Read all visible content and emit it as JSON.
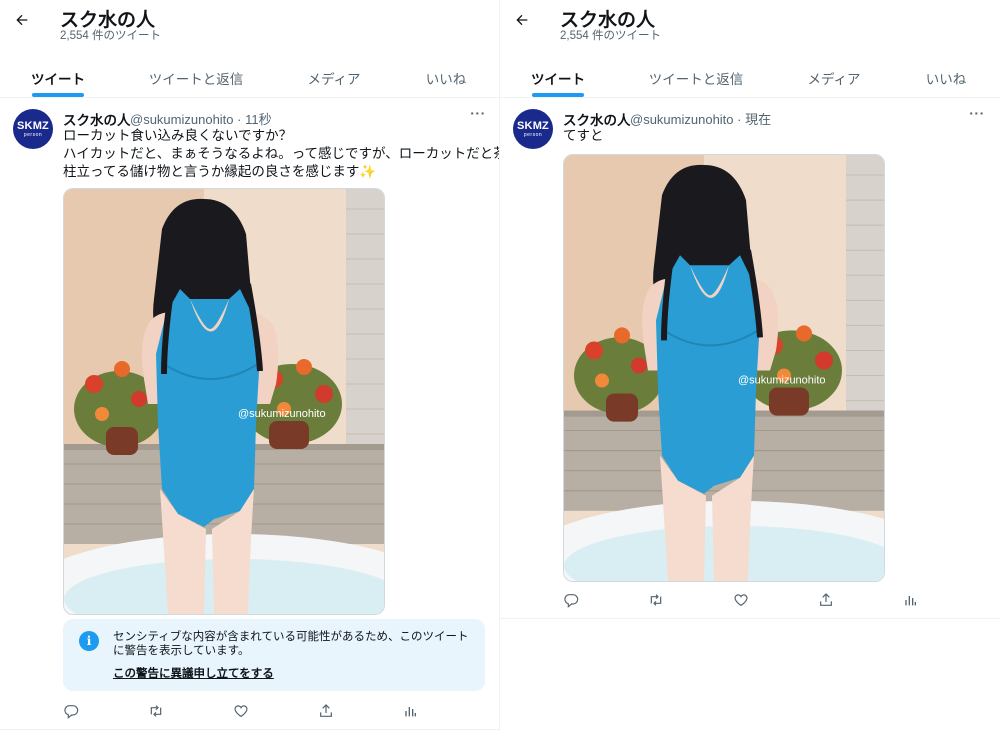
{
  "left": {
    "header": {
      "title": "スク水の人",
      "count": "2,554 件のツイート"
    },
    "tabs": [
      {
        "label": "ツイート"
      },
      {
        "label": "ツイートと返信"
      },
      {
        "label": "メディア"
      },
      {
        "label": "いいね"
      }
    ],
    "tweet": {
      "name": "スク水の人",
      "meta": "@sukumizunohito · 11秒",
      "lines": [
        "ローカット食い込み良くないですか？",
        "ハイカットだと、まぁそうなるよね。って感じですが、ローカットだと茶",
        "柱立ってる儲け物と言うか縁起の良さを感じます✨"
      ],
      "watermark": "@sukumizunohito",
      "warning": {
        "text": "センシティブな内容が含まれている可能性があるため、このツイートに警告を表示しています。",
        "link": "この警告に異議申し立てをする"
      }
    }
  },
  "right": {
    "header": {
      "title": "スク水の人",
      "count": "2,554 件のツイート"
    },
    "tabs": [
      {
        "label": "ツイート"
      },
      {
        "label": "ツイートと返信"
      },
      {
        "label": "メディア"
      },
      {
        "label": "いいね"
      }
    ],
    "tweet": {
      "name": "スク水の人",
      "meta": "@sukumizunohito · 現在",
      "lines": [
        "てすと"
      ],
      "watermark": "@sukumizunohito"
    }
  },
  "avatar": {
    "main": "SKMZ",
    "sub": "person"
  },
  "more_glyph": "···",
  "icons": [
    "back-arrow-icon",
    "more-icon",
    "info-icon",
    "reply-icon",
    "retweet-icon",
    "like-icon",
    "share-icon",
    "analytics-icon"
  ],
  "colors": {
    "accent": "#1d9bf0",
    "text": "#0f1419",
    "muted": "#536471",
    "warn_bg": "#e8f5fd",
    "swimsuit": "#2a9ed4"
  }
}
